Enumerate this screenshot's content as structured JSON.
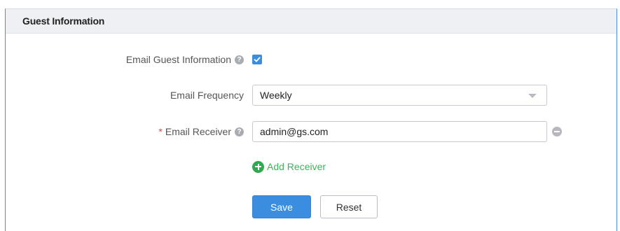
{
  "section": {
    "title": "Guest Information"
  },
  "form": {
    "email_guest_info": {
      "label": "Email Guest Information",
      "checked": true
    },
    "email_frequency": {
      "label": "Email Frequency",
      "value": "Weekly"
    },
    "email_receiver": {
      "required_mark": "*",
      "label": "Email Receiver",
      "value": "admin@gs.com"
    },
    "add_receiver_label": "Add Receiver"
  },
  "buttons": {
    "save": "Save",
    "reset": "Reset"
  },
  "icons": {
    "help": "question-circle-icon",
    "remove": "minus-circle-icon",
    "add": "plus-circle-icon",
    "caret": "chevron-down-icon"
  },
  "colors": {
    "accent": "#3b8de0",
    "add_green": "#2fa94e",
    "required_red": "#e64545",
    "frame_blue": "#4a90d9"
  }
}
